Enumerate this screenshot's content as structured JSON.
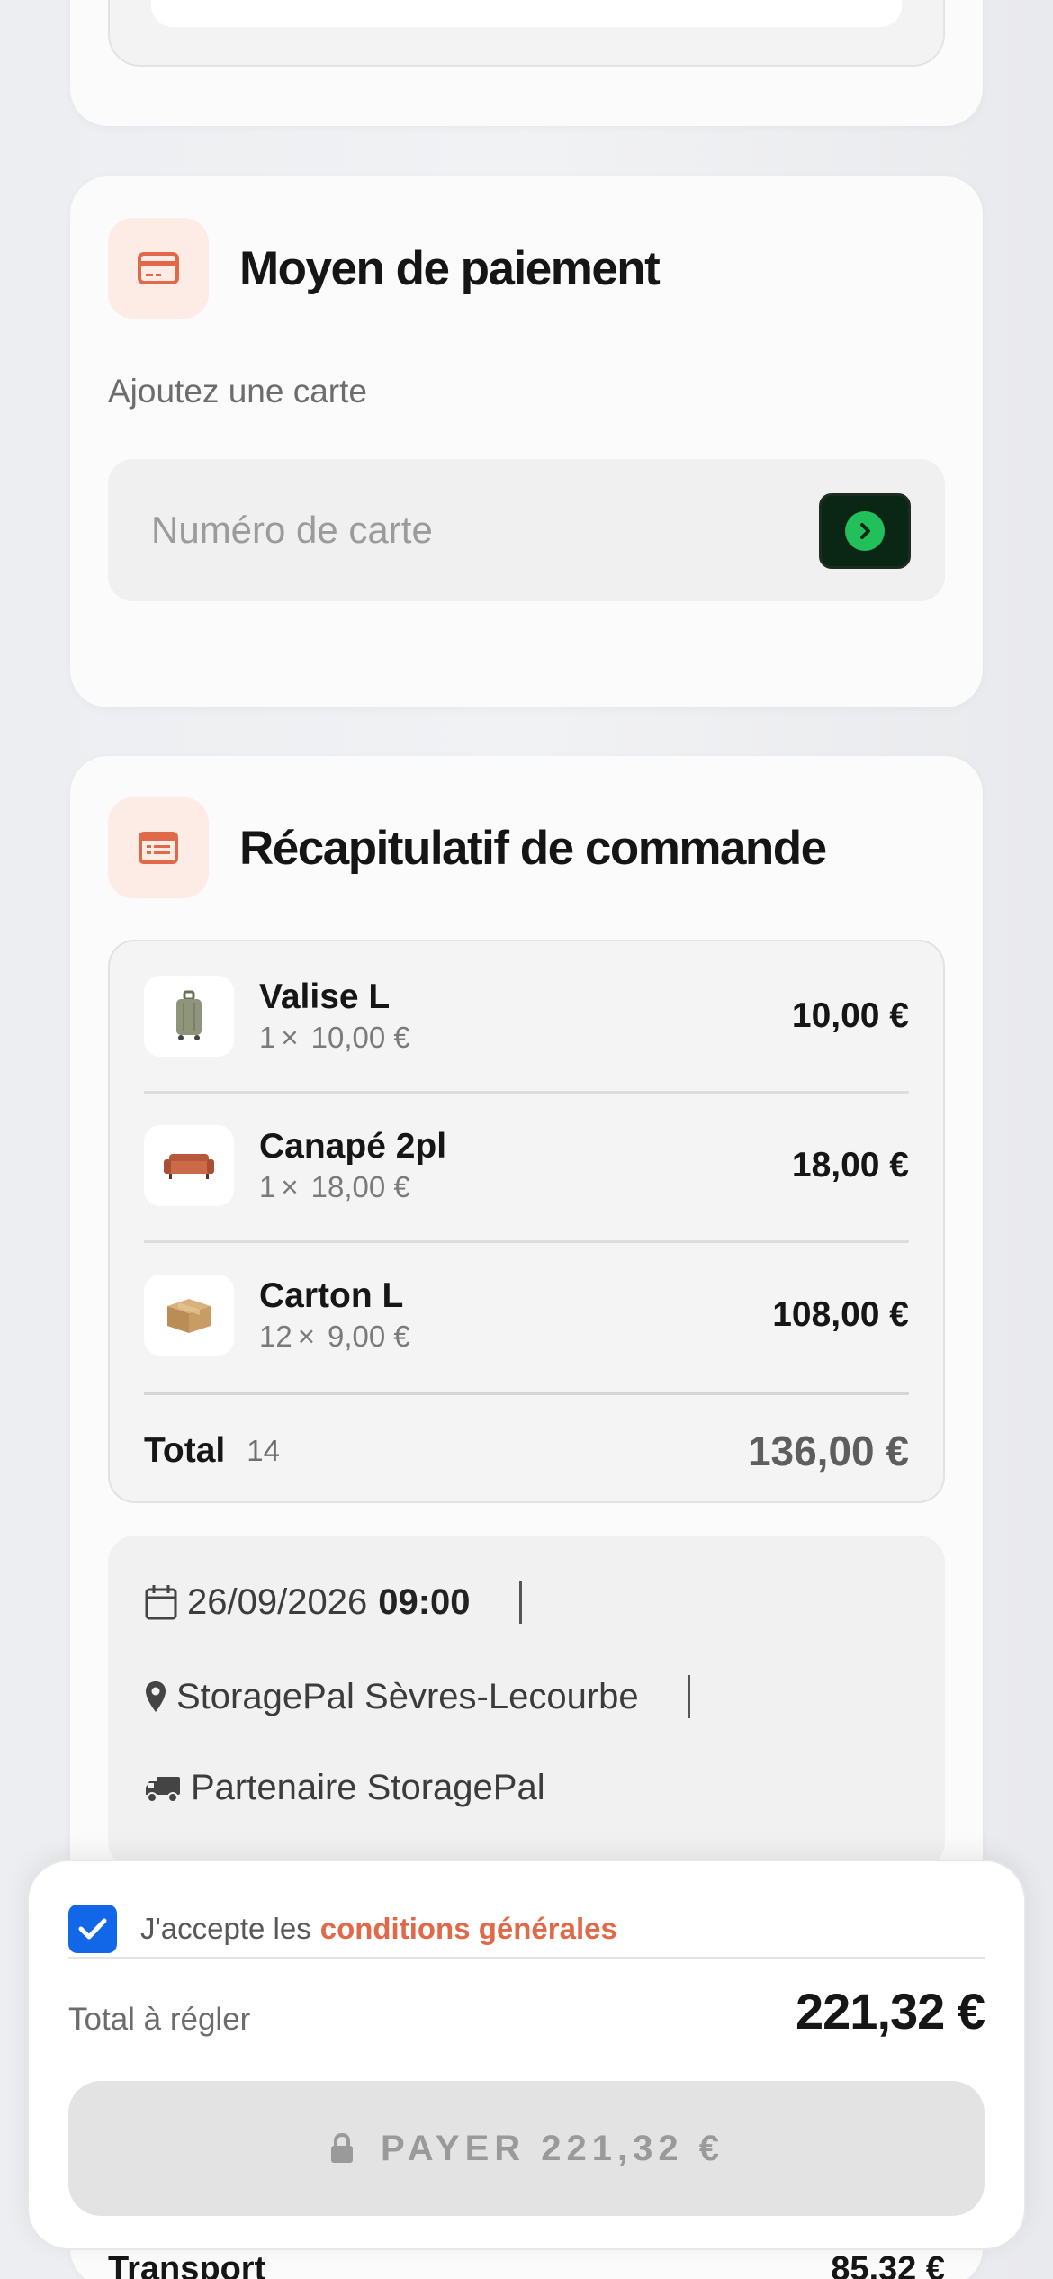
{
  "payment": {
    "title": "Moyen de paiement",
    "subtitle": "Ajoutez une carte",
    "card_placeholder": "Numéro de carte",
    "icon": "credit-card-icon"
  },
  "recap": {
    "title": "Récapitulatif de commande",
    "icon": "receipt-list-icon",
    "items": [
      {
        "name": "Valise L",
        "qty": "1",
        "unit_price": "10,00 €",
        "price": "10,00 €",
        "icon": "suitcase-icon"
      },
      {
        "name": "Canapé 2pl",
        "qty": "1",
        "unit_price": "18,00 €",
        "price": "18,00 €",
        "icon": "sofa-icon"
      },
      {
        "name": "Carton L",
        "qty": "12",
        "unit_price": "9,00 €",
        "price": "108,00 €",
        "icon": "box-icon"
      }
    ],
    "qty_sign": "×",
    "total_label": "Total",
    "total_count": "14",
    "total_value": "136,00 €",
    "details": {
      "date": "26/09/2026",
      "time": "09:00",
      "location": "StoragePal Sèvres-Lecourbe",
      "partner": "Partenaire StoragePal"
    },
    "transport_label": "Transport",
    "transport_value": "85,32 €"
  },
  "checkout": {
    "terms_prefix": "J'accepte les",
    "terms_link": "conditions générales",
    "terms_checked": true,
    "due_label": "Total à régler",
    "due_value": "221,32 €",
    "pay_button": "PAYER 221,32 €"
  },
  "colors": {
    "accent": "#e0694a",
    "accent_soft": "#fdebe5",
    "checkbox": "#1267e8",
    "go_button": "#0a2614",
    "go_dot": "#21c05a"
  }
}
